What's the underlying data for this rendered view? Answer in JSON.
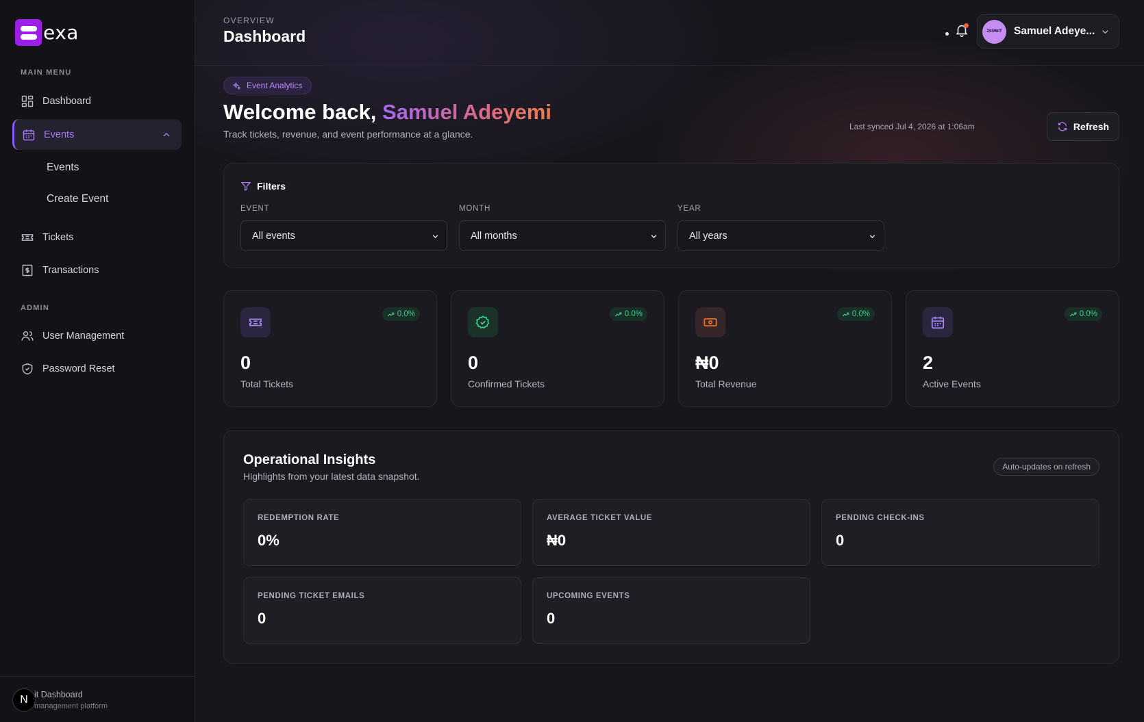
{
  "brand": {
    "name": "exa"
  },
  "sidebar": {
    "main_menu_label": "MAIN MENU",
    "admin_label": "ADMIN",
    "items": [
      {
        "label": "Dashboard",
        "icon": "grid-icon"
      },
      {
        "label": "Events",
        "icon": "calendar-icon",
        "active": true
      },
      {
        "label": "Tickets",
        "icon": "ticket-icon"
      },
      {
        "label": "Transactions",
        "icon": "receipt-icon"
      }
    ],
    "sub_items": [
      "Events",
      "Create Event"
    ],
    "admin_items": [
      {
        "label": "User Management",
        "icon": "users-icon"
      },
      {
        "label": "Password Reset",
        "icon": "shield-icon"
      }
    ],
    "footer": {
      "badge": "N",
      "title": "it Dashboard",
      "subtitle": "management platform"
    }
  },
  "header": {
    "overline": "OVERVIEW",
    "title": "Dashboard",
    "user": {
      "name": "Samuel Adeye...",
      "avatar_text": "ZEMBIT"
    }
  },
  "hero": {
    "badge": "Event Analytics",
    "welcome_prefix": "Welcome back,",
    "welcome_name": "Samuel Adeyemi",
    "subtitle": "Track tickets, revenue, and event performance at a glance.",
    "sync_text": "Last synced Jul 4, 2026 at 1:06am",
    "refresh_label": "Refresh"
  },
  "filters": {
    "title": "Filters",
    "fields": [
      {
        "label": "EVENT",
        "value": "All events"
      },
      {
        "label": "MONTH",
        "value": "All months"
      },
      {
        "label": "YEAR",
        "value": "All years"
      }
    ]
  },
  "stats": [
    {
      "value": "0",
      "label": "Total Tickets",
      "trend": "0.0%",
      "icon": "ticket-icon",
      "color": "#a78bfa"
    },
    {
      "value": "0",
      "label": "Confirmed Tickets",
      "trend": "0.0%",
      "icon": "check-circle-icon",
      "color": "#34d399"
    },
    {
      "value": "₦0",
      "label": "Total Revenue",
      "trend": "0.0%",
      "icon": "banknote-icon",
      "color": "#f97316"
    },
    {
      "value": "2",
      "label": "Active Events",
      "trend": "0.0%",
      "icon": "calendar-icon",
      "color": "#a78bfa"
    }
  ],
  "insights": {
    "title": "Operational Insights",
    "subtitle": "Highlights from your latest data snapshot.",
    "badge": "Auto-updates on refresh",
    "metrics": [
      {
        "label": "REDEMPTION RATE",
        "value": "0%"
      },
      {
        "label": "AVERAGE TICKET VALUE",
        "value": "₦0"
      },
      {
        "label": "PENDING CHECK-INS",
        "value": "0"
      },
      {
        "label": "PENDING TICKET EMAILS",
        "value": "0"
      },
      {
        "label": "UPCOMING EVENTS",
        "value": "0"
      }
    ]
  },
  "colors": {
    "accent": "#8b5cf6",
    "success": "#47c98e",
    "notification": "#f0603a"
  }
}
